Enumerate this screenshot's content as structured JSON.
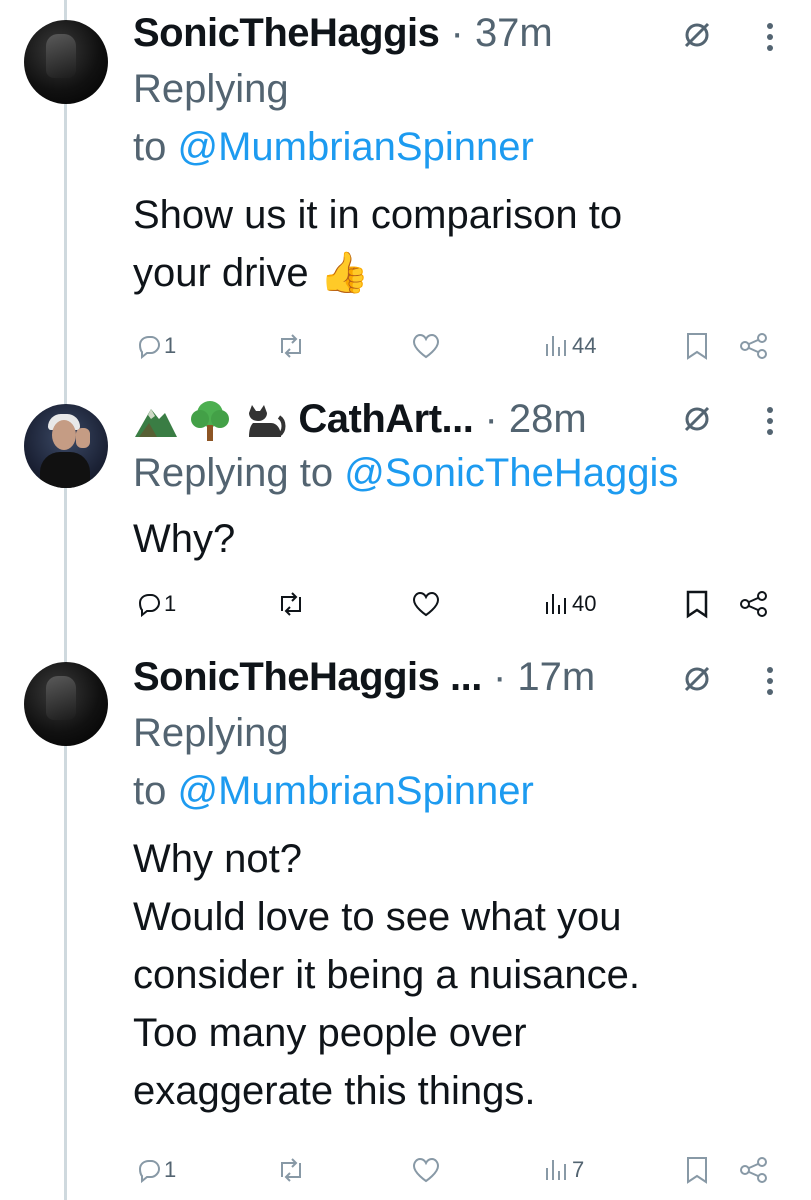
{
  "tweets": [
    {
      "author": "SonicTheHaggis",
      "sep": " · ",
      "time": "37m",
      "reply_lines": [
        "Replying",
        "to "
      ],
      "reply_handle": "@MumbrianSpinner",
      "text_lines": [
        "Show us it in comparison to",
        "your drive "
      ],
      "emoji": "👍",
      "replies": "1",
      "reposts": "",
      "likes": "",
      "views": "44"
    },
    {
      "author": "CathArt...",
      "sep": " · ",
      "time": "28m",
      "reply_lines": [
        "Replying to "
      ],
      "reply_handle": "@SonicTheHaggis",
      "text_lines": [
        "Why?"
      ],
      "replies": "1",
      "reposts": "",
      "likes": "",
      "views": "40"
    },
    {
      "author": "SonicTheHaggis",
      "author_suffix": " ...",
      "sep": " · ",
      "time": "17m",
      "reply_lines": [
        "Replying",
        "to "
      ],
      "reply_handle": "@MumbrianSpinner",
      "text_lines": [
        "Why not?",
        "Would love to see what you",
        "consider it being a nuisance.",
        "Too many people over",
        "exaggerate this things."
      ],
      "replies": "1",
      "reposts": "",
      "likes": "",
      "views": "7"
    }
  ],
  "colors": {
    "link": "#1d9bf0",
    "muted": "#536471",
    "text": "#0f1419",
    "thread": "#cfd9de"
  }
}
